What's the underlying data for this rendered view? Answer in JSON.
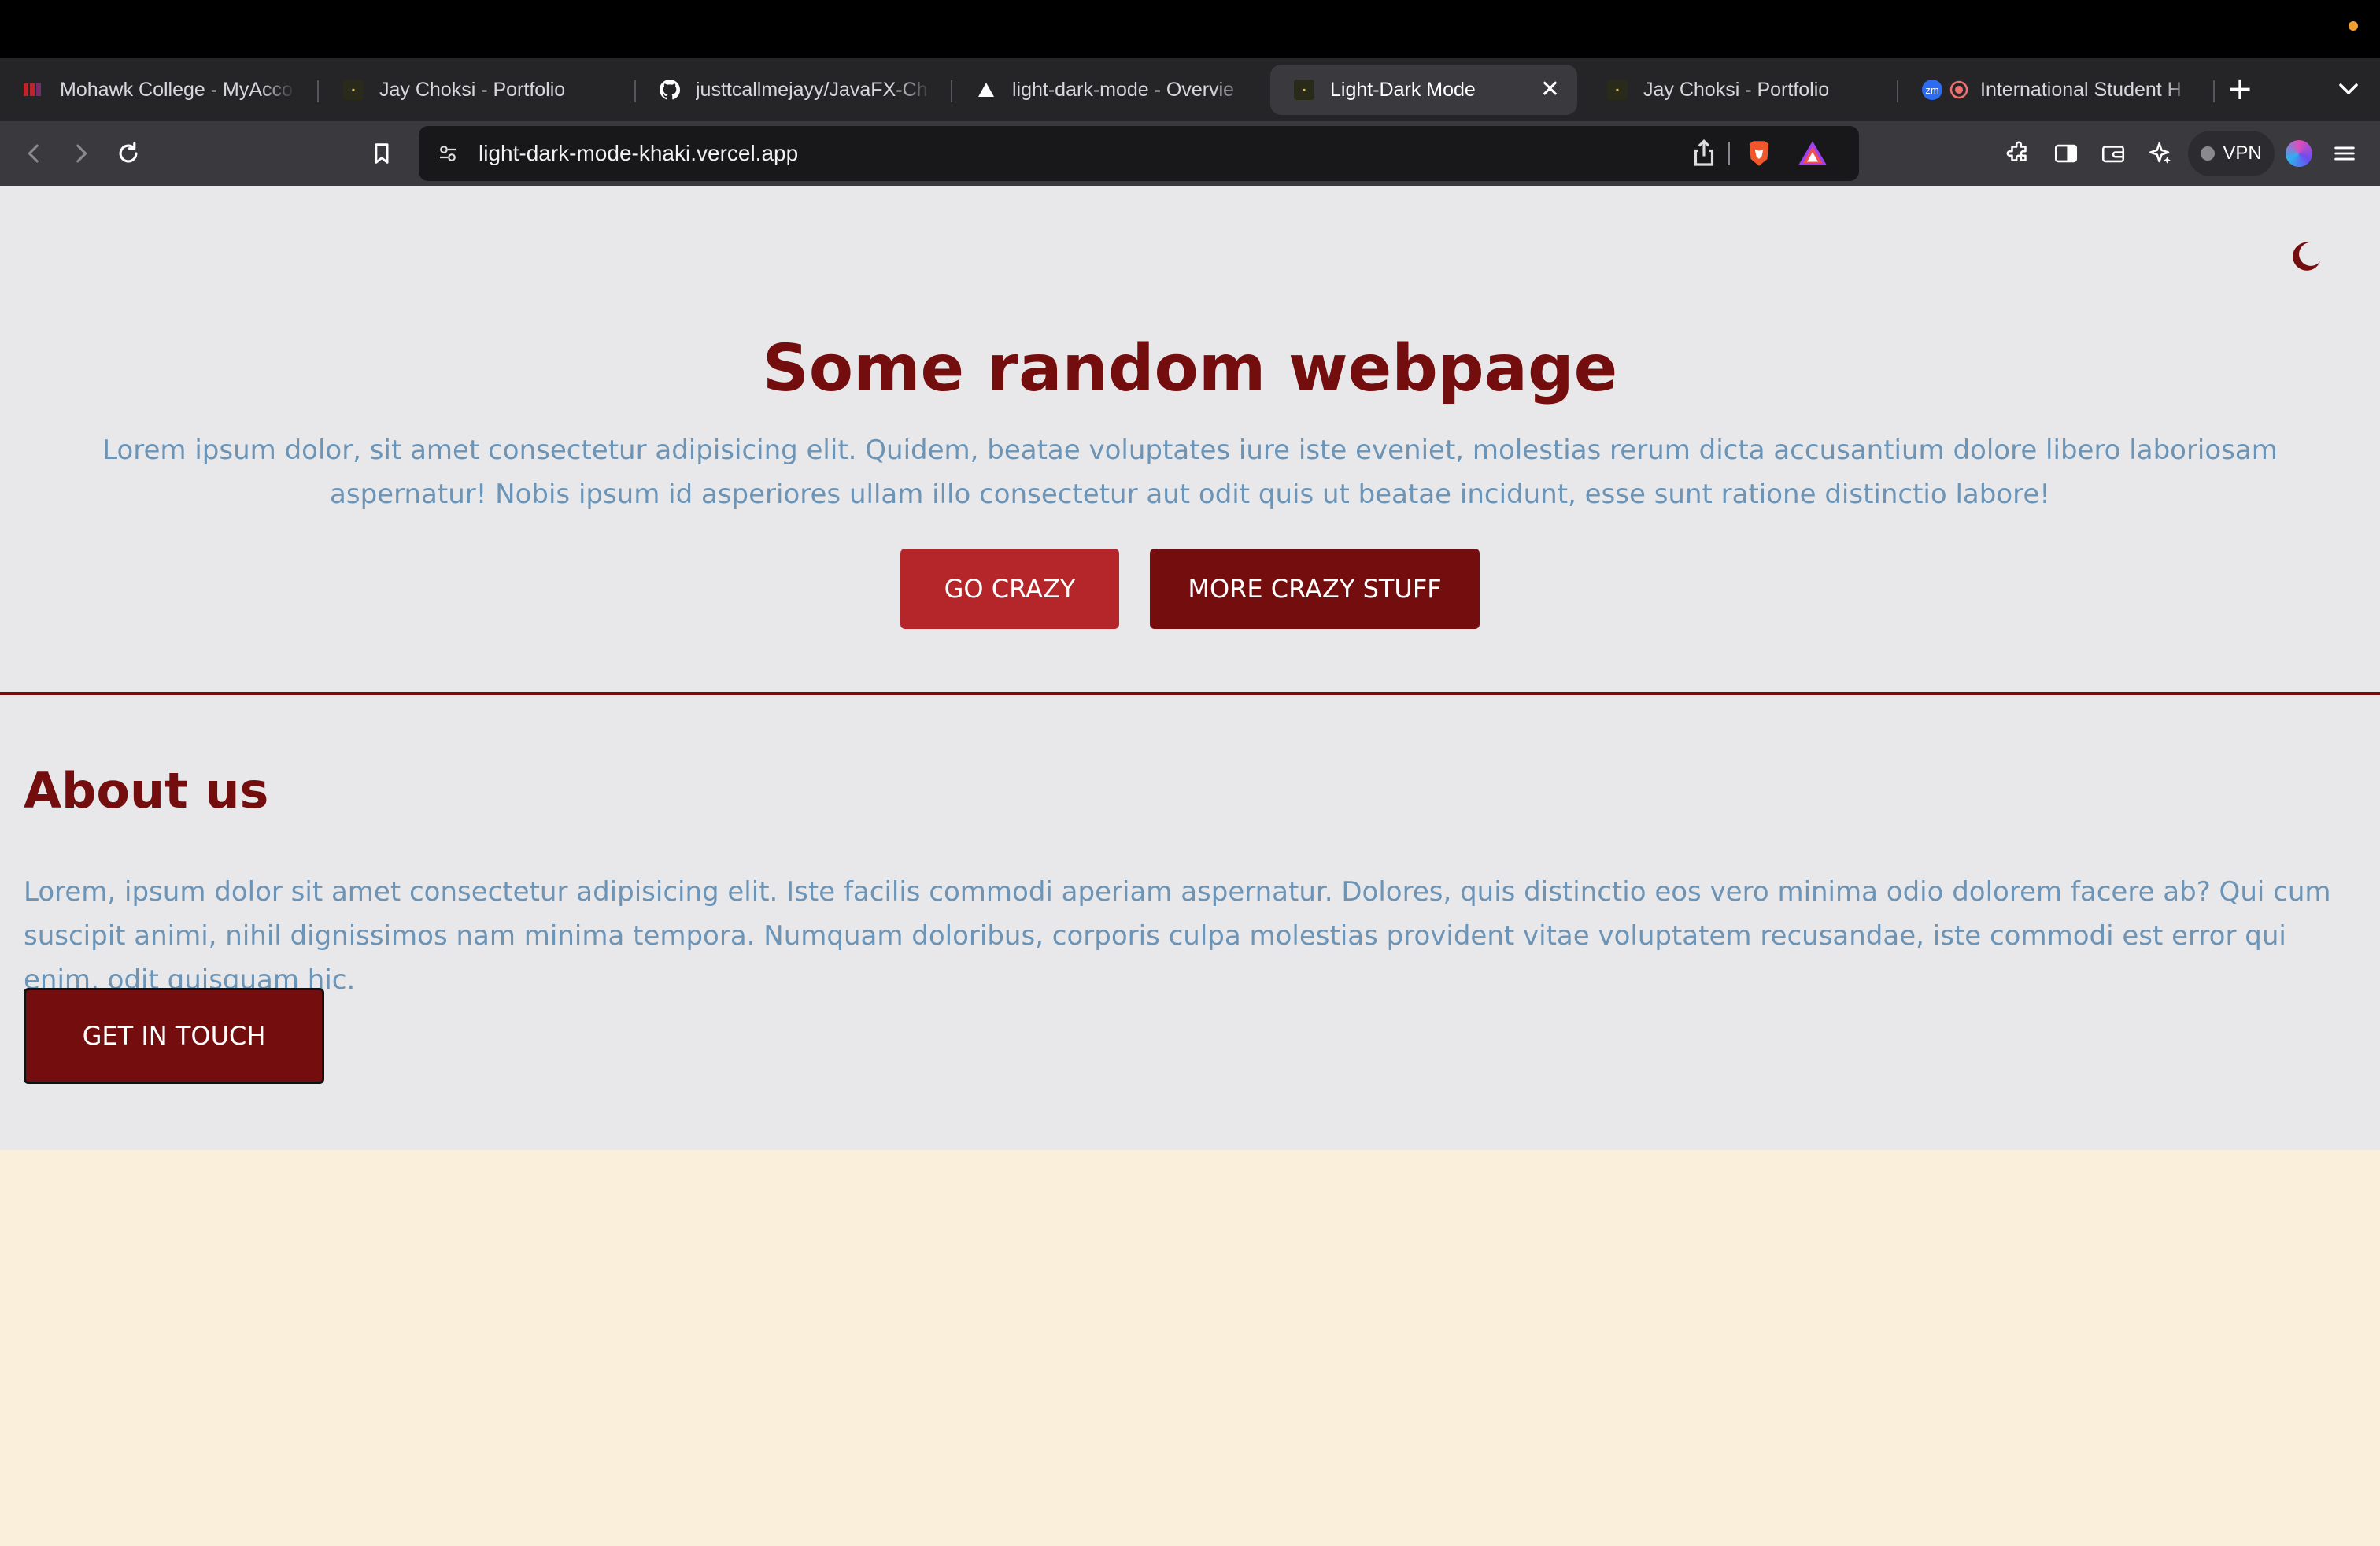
{
  "browser": {
    "tabs": [
      {
        "title": "Mohawk College - MyAcco",
        "icon": "mohawk-favicon",
        "active": false
      },
      {
        "title": "Jay Choksi - Portfolio",
        "icon": "portfolio-favicon",
        "active": false
      },
      {
        "title": "justtcallmejayy/JavaFX-Ch",
        "icon": "github-icon",
        "active": false
      },
      {
        "title": "light-dark-mode - Overvie",
        "icon": "vercel-icon",
        "active": false
      },
      {
        "title": "Light-Dark Mode",
        "icon": "portfolio-favicon",
        "active": true
      },
      {
        "title": "Jay Choksi - Portfolio",
        "icon": "portfolio-favicon",
        "active": false
      },
      {
        "title": "International Student H",
        "icon": "zoom-favicon",
        "active": false
      }
    ],
    "url": "light-dark-mode-khaki.vercel.app",
    "vpn_label": "VPN",
    "new_tab_glyph": "+",
    "close_glyph": "✕"
  },
  "page": {
    "hero": {
      "title": "Some random webpage",
      "text": "Lorem ipsum dolor, sit amet consectetur adipisicing elit. Quidem, beatae voluptates iure iste eveniet, molestias rerum dicta accusantium dolore libero laboriosam aspernatur! Nobis ipsum id asperiores ullam illo consectetur aut odit quis ut beatae incidunt, esse sunt ratione distinctio labore!",
      "primary_button": "GO CRAZY",
      "secondary_button": "MORE CRAZY STUFF"
    },
    "about": {
      "title": "About us",
      "text": "Lorem, ipsum dolor sit amet consectetur adipisicing elit. Iste facilis commodi aperiam aspernatur. Dolores, quis distinctio eos vero minima odio dolorem facere ab? Qui cum suscipit animi, nihil dignissimos nam minima tempora. Numquam doloribus, corporis culpa molestias provident vitae voluptatem recusandae, iste commodi est error qui enim, odit quisquam hic.",
      "button": "GET IN TOUCH"
    }
  },
  "colors": {
    "heading": "#740e0e",
    "body_text": "#6b94b6",
    "primary_button": "#b5262b",
    "secondary_button": "#740e0e",
    "section_bg": "#e8e8eb",
    "page_bg": "#faefda"
  },
  "theme_toggle_icon": "moon-icon"
}
